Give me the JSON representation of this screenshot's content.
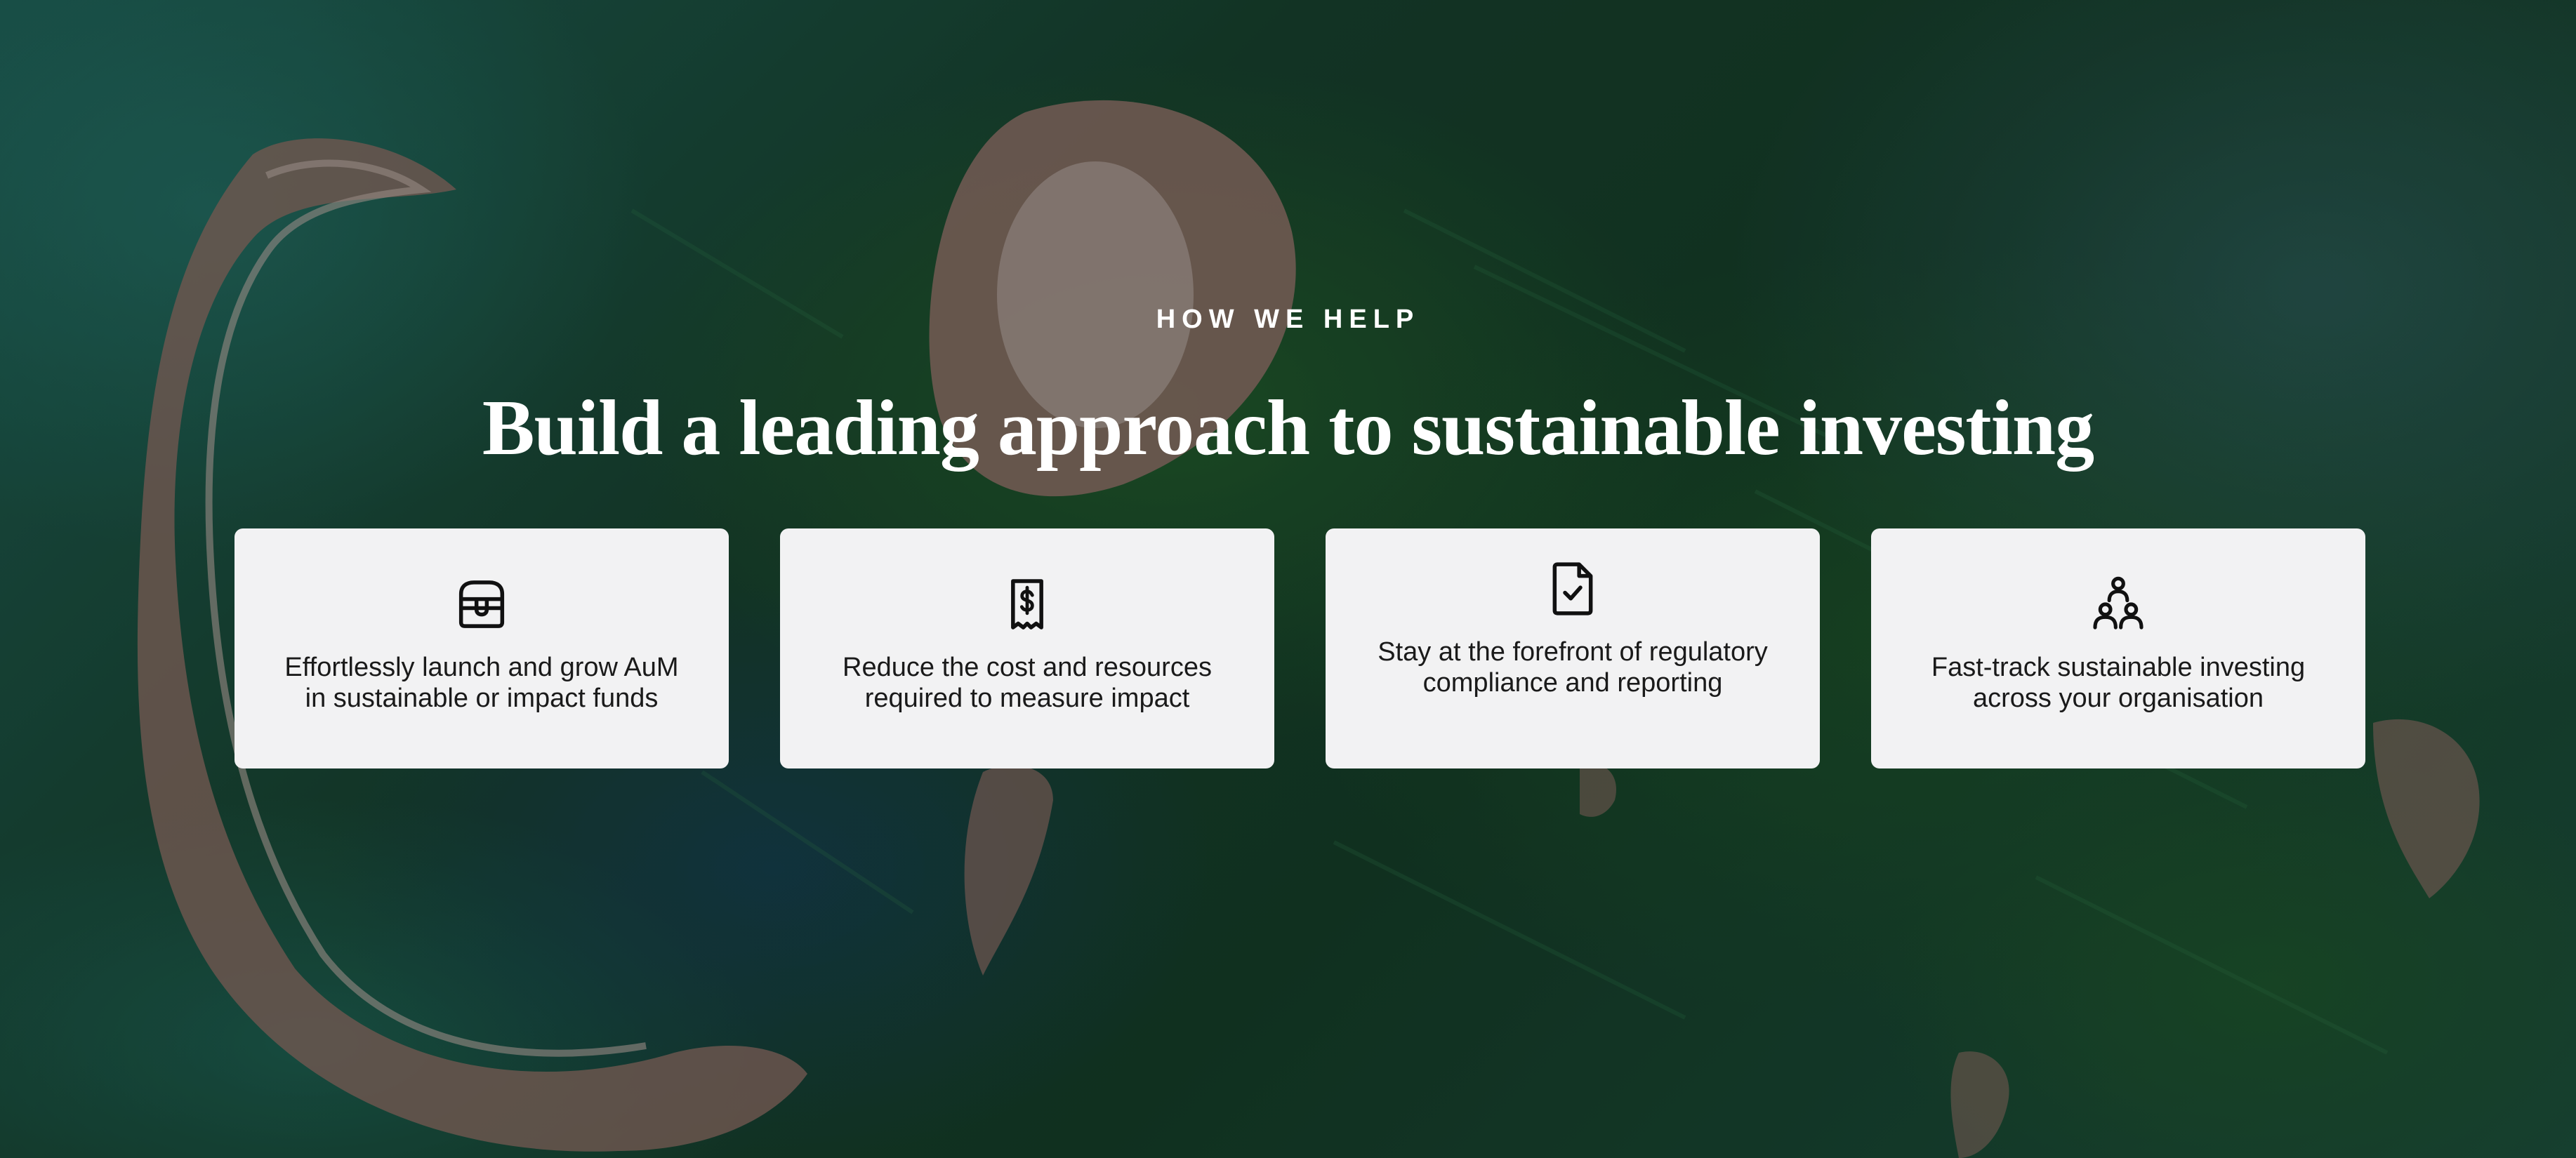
{
  "section": {
    "eyebrow": "HOW WE HELP",
    "headline": "Build a leading approach to sustainable investing"
  },
  "cards": [
    {
      "icon": "treasure-chest-icon",
      "text": "Effortlessly launch and grow AuM in sustainable or impact funds"
    },
    {
      "icon": "dollar-receipt-icon",
      "text": "Reduce the cost and resources required to measure impact"
    },
    {
      "icon": "document-check-icon",
      "text": "Stay at the forefront of regulatory compliance and reporting"
    },
    {
      "icon": "team-people-icon",
      "text": "Fast-track sustainable investing across your organisation"
    }
  ],
  "colors": {
    "card_background": "#f2f2f3",
    "card_text": "#1a1a1a",
    "heading_text": "#ffffff"
  }
}
